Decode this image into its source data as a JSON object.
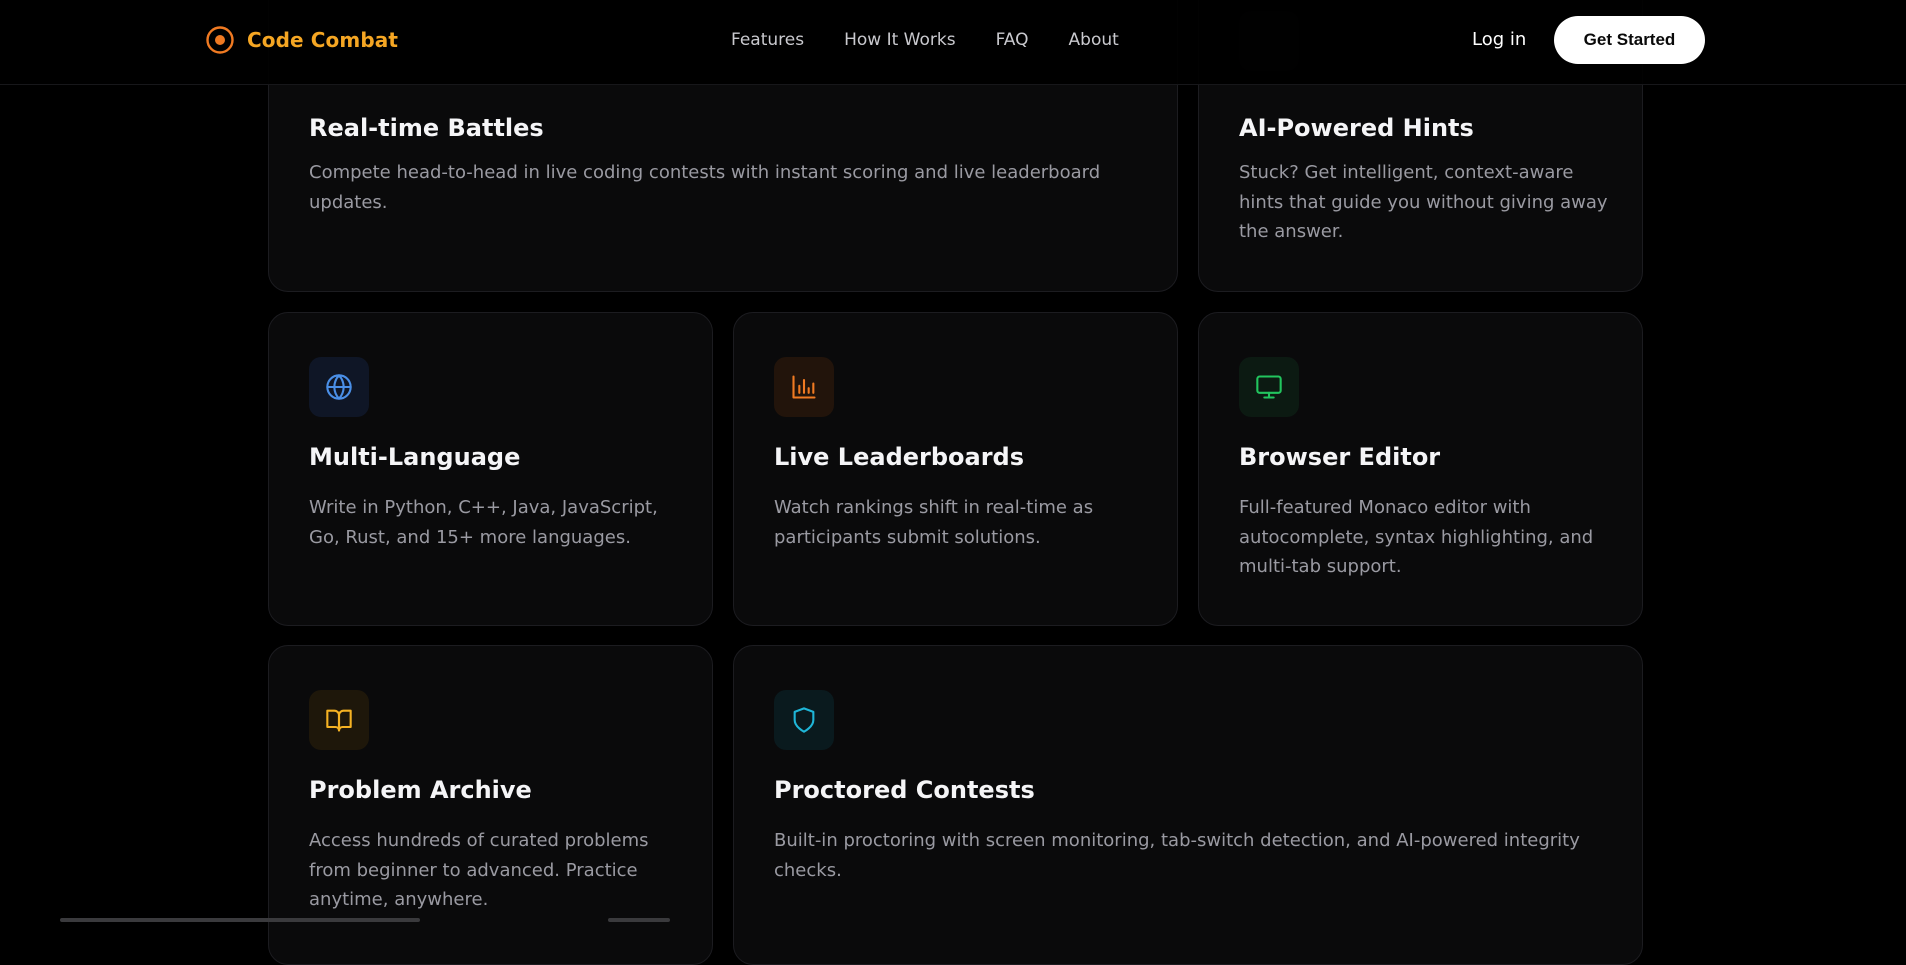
{
  "nav": {
    "brand": "Code Combat",
    "links": [
      "Features",
      "How It Works",
      "FAQ",
      "About"
    ],
    "login": "Log in",
    "cta": "Get Started"
  },
  "features": {
    "realtime": {
      "title": "Real-time Battles",
      "description": "Compete head-to-head in live coding contests with instant scoring and live leaderboard updates."
    },
    "hints": {
      "title": "AI-Powered Hints",
      "description": "Stuck? Get intelligent, context-aware hints that guide you without giving away the answer."
    },
    "multilang": {
      "title": "Multi-Language",
      "description": "Write in Python, C++, Java, JavaScript, Go, Rust, and 15+ more languages.",
      "icon": "globe-icon"
    },
    "leaderboards": {
      "title": "Live Leaderboards",
      "description": "Watch rankings shift in real-time as participants submit solutions.",
      "icon": "bar-chart-icon"
    },
    "editor": {
      "title": "Browser Editor",
      "description": "Full-featured Monaco editor with autocomplete, syntax highlighting, and multi-tab support.",
      "icon": "monitor-icon"
    },
    "archive": {
      "title": "Problem Archive",
      "description": "Access hundreds of curated problems from beginner to advanced. Practice anytime, anywhere.",
      "icon": "book-icon"
    },
    "proctored": {
      "title": "Proctored Contests",
      "description": "Built-in proctoring with screen monitoring, tab-switch detection, and AI-powered integrity checks.",
      "icon": "shield-icon"
    }
  },
  "colors": {
    "brand": "#f5a623",
    "background": "#000000",
    "card": "#0a0a0b",
    "globe": "#4a8fe7",
    "chart": "#f07a22",
    "monitor": "#22c55e",
    "book": "#f5b223",
    "shield": "#1fb6d8"
  }
}
